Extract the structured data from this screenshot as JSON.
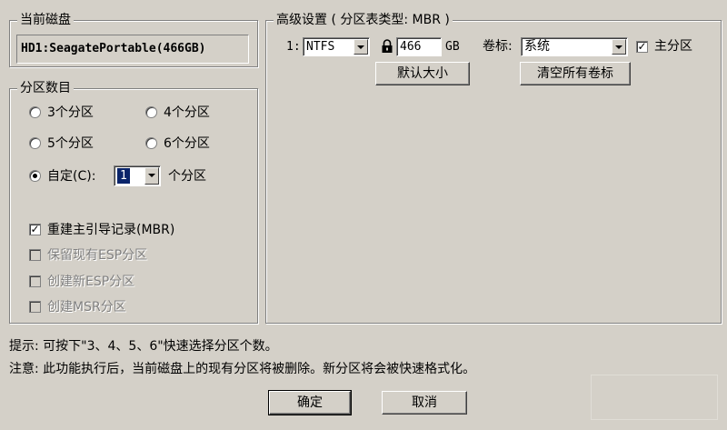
{
  "disk_group": {
    "title": "当前磁盘",
    "disk_name": "HD1:SeagatePortable(466GB)"
  },
  "partition_count": {
    "title": "分区数目",
    "options": [
      {
        "label": "3个分区",
        "selected": false
      },
      {
        "label": "4个分区",
        "selected": false
      },
      {
        "label": "5个分区",
        "selected": false
      },
      {
        "label": "6个分区",
        "selected": false
      },
      {
        "label": "自定(C):",
        "selected": true
      }
    ],
    "custom_value": "1",
    "custom_suffix": "个分区"
  },
  "options_checks": [
    {
      "label": "重建主引导记录(MBR)",
      "checked": true,
      "enabled": true
    },
    {
      "label": "保留现有ESP分区",
      "checked": false,
      "enabled": false
    },
    {
      "label": "创建新ESP分区",
      "checked": false,
      "enabled": false
    },
    {
      "label": "创建MSR分区",
      "checked": false,
      "enabled": false
    }
  ],
  "advanced": {
    "title": "高级设置 ( 分区表类型: MBR )",
    "row_index": "1:",
    "filesystem": "NTFS",
    "size_value": "466",
    "size_unit": "GB",
    "volume_label_caption": "卷标:",
    "volume_label_value": "系统",
    "primary_label": "主分区",
    "primary_checked": true,
    "default_size_button": "默认大小",
    "clear_labels_button": "清空所有卷标"
  },
  "hints": {
    "tip": "提示: 可按下\"3、4、5、6\"快速选择分区个数。",
    "note": "注意: 此功能执行后，当前磁盘上的现有分区将被删除。新分区将会被快速格式化。"
  },
  "buttons": {
    "ok": "确定",
    "cancel": "取消"
  },
  "colors": {
    "dialog_bg": "#d4d0c8",
    "disabled_text": "#808080",
    "selection": "#0a246a"
  }
}
